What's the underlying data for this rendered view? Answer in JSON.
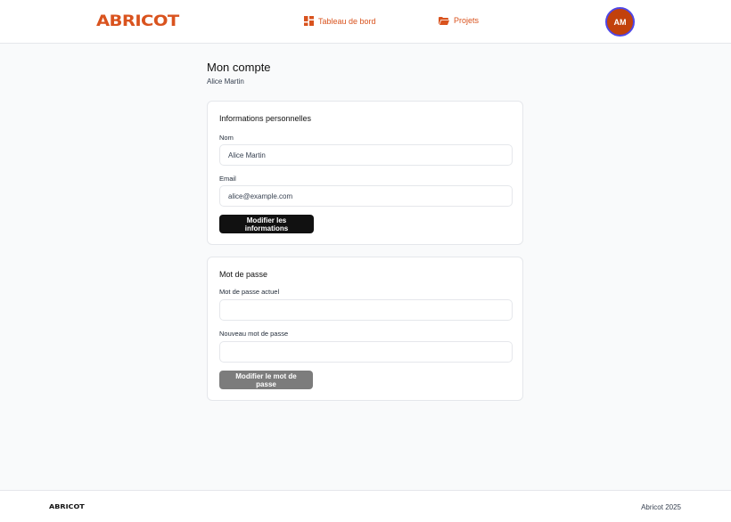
{
  "header": {
    "logo": "ABRICOT",
    "nav": [
      {
        "label": "Tableau de bord",
        "icon": "dashboard-grid-icon"
      },
      {
        "label": "Projets",
        "icon": "folder-open-icon"
      }
    ],
    "avatar_initials": "AM"
  },
  "colors": {
    "brand": "#d9531e",
    "avatar_bg": "#c2410c",
    "avatar_ring": "#4f46e5",
    "primary_button": "#111111",
    "disabled_button": "#7c7c7c"
  },
  "page": {
    "title": "Mon compte",
    "subtitle": "Alice Martin"
  },
  "personal_info": {
    "title": "Informations personnelles",
    "name_label": "Nom",
    "name_value": "Alice Martin",
    "email_label": "Email",
    "email_value": "alice@example.com",
    "submit_label": "Modifier les informations"
  },
  "password": {
    "title": "Mot de passe",
    "current_label": "Mot de passe actuel",
    "current_value": "",
    "new_label": "Nouveau mot de passe",
    "new_value": "",
    "submit_label": "Modifier le mot de passe"
  },
  "footer": {
    "logo": "ABRICOT",
    "copyright": "Abricot 2025"
  }
}
